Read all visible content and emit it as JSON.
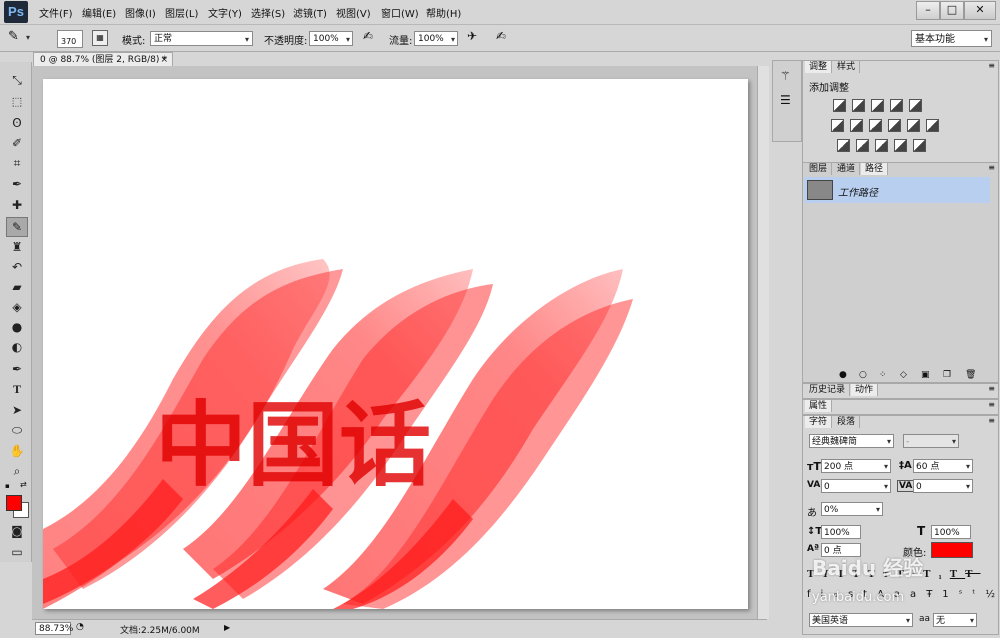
{
  "app": {
    "logo": "Ps"
  },
  "menu": [
    {
      "label": "文件(F)"
    },
    {
      "label": "编辑(E)"
    },
    {
      "label": "图像(I)"
    },
    {
      "label": "图层(L)"
    },
    {
      "label": "文字(Y)"
    },
    {
      "label": "选择(S)"
    },
    {
      "label": "滤镜(T)"
    },
    {
      "label": "视图(V)"
    },
    {
      "label": "窗口(W)"
    },
    {
      "label": "帮助(H)"
    }
  ],
  "window_buttons": {
    "minimize": "–",
    "restore": "□",
    "close": "✕"
  },
  "options": {
    "brush_size": "370",
    "mode_label": "模式:",
    "mode_value": "正常",
    "opacity_label": "不透明度:",
    "opacity_value": "100%",
    "flow_label": "流量:",
    "flow_value": "100%",
    "workspace": "基本功能"
  },
  "document": {
    "tab_title": "0 @ 88.7% (图层 2, RGB/8) *",
    "artwork_text": "中国话"
  },
  "status": {
    "zoom": "88.73%",
    "doc_info": "文档:2.25M/6.00M"
  },
  "colors": {
    "foreground": "#ff0000",
    "background": "#ffffff",
    "accent_selected": "#b9cff0",
    "text_color_swatch": "#ff0000"
  },
  "adjustments_panel": {
    "tabs": [
      "调整",
      "样式"
    ],
    "title": "添加调整",
    "rows": [
      [
        "brightness-icon",
        "levels-icon",
        "curves-icon",
        "exposure-icon",
        "vibrance-icon"
      ],
      [
        "hue-icon",
        "balance-icon",
        "bw-icon",
        "photo-filter-icon",
        "mixer-icon",
        "lookup-icon"
      ],
      [
        "invert-icon",
        "posterize-icon",
        "threshold-icon",
        "selective-color-icon",
        "gradient-map-icon"
      ]
    ]
  },
  "layers_panel": {
    "tabs": [
      "图层",
      "通道",
      "路径"
    ],
    "active_tab": 2,
    "items": [
      {
        "label": "工作路径"
      }
    ]
  },
  "history_panel": {
    "tabs": [
      "历史记录",
      "动作"
    ]
  },
  "properties_panel": {
    "tabs": [
      "属性"
    ]
  },
  "character_panel": {
    "tabs": [
      "字符",
      "段落"
    ],
    "font_family": "经典魏碑简",
    "font_style": "-",
    "font_size": "200 点",
    "leading": "60 点",
    "kerning": "0",
    "tracking": "0",
    "scale_percent": "0%",
    "vertical_scale": "100%",
    "horizontal_scale": "100%",
    "baseline": "0 点",
    "color_label": "颜色:",
    "language": "美国英语",
    "antialias_label": "aa",
    "antialias": "无"
  },
  "watermark": {
    "text": "Baidu 经验",
    "url": "yanbaidu.com"
  }
}
